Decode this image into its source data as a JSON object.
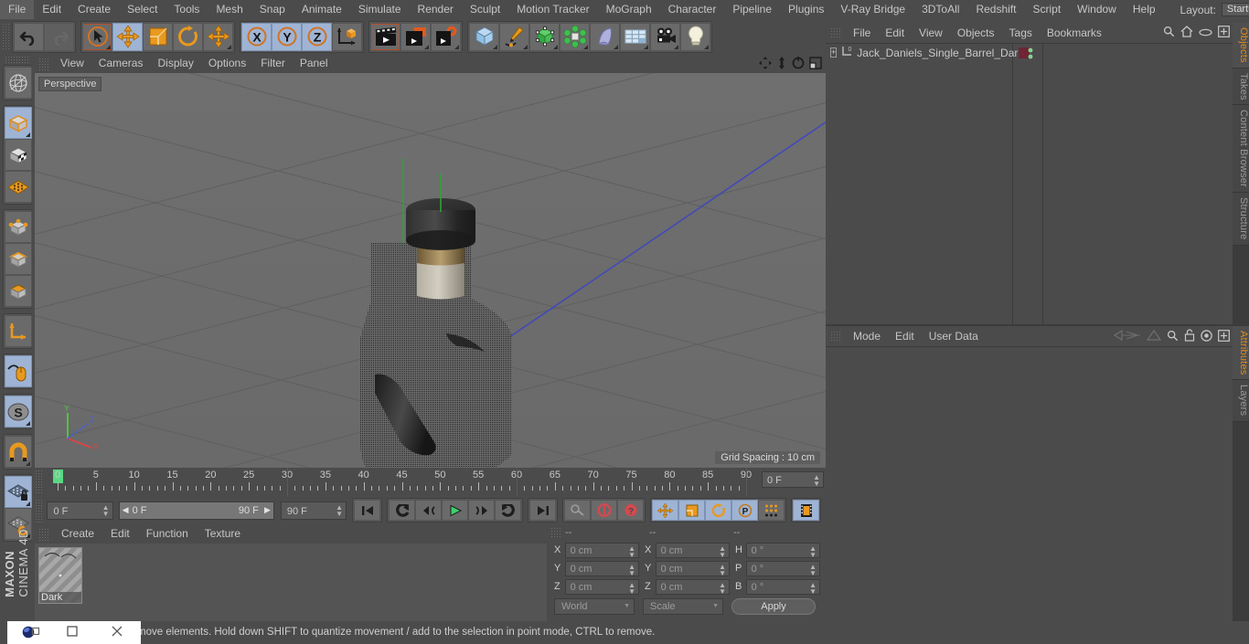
{
  "app": {
    "title": "MAXON CINEMA 4D",
    "brand_line1": "MAXON",
    "brand_line2": "CINEMA 4D"
  },
  "menubar": {
    "items": [
      "File",
      "Edit",
      "Create",
      "Select",
      "Tools",
      "Mesh",
      "Snap",
      "Animate",
      "Simulate",
      "Render",
      "Sculpt",
      "Motion Tracker",
      "MoGraph",
      "Character",
      "Pipeline",
      "Plugins",
      "V-Ray Bridge",
      "3DToAll",
      "Redshift",
      "Script",
      "Window",
      "Help"
    ],
    "layout_label": "Layout:",
    "layout_value": "Startup",
    "search_icon": "search-icon"
  },
  "toolbar": {
    "groups": [
      {
        "name": "history",
        "buttons": [
          {
            "name": "undo-button",
            "icon": "undo-arrow",
            "selected": false,
            "disabled": false
          },
          {
            "name": "redo-button",
            "icon": "redo-arrow",
            "selected": false,
            "disabled": true
          }
        ]
      },
      {
        "name": "transform",
        "buttons": [
          {
            "name": "live-selection-tool",
            "icon": "cursor-circle",
            "selected": false,
            "disabled": false,
            "outlined": true,
            "corner": true
          },
          {
            "name": "move-tool",
            "icon": "move-cross",
            "selected": true,
            "disabled": false
          },
          {
            "name": "scale-tool",
            "icon": "scale-box",
            "selected": false,
            "disabled": false
          },
          {
            "name": "rotate-tool",
            "icon": "rotate-arc",
            "selected": false,
            "disabled": false
          },
          {
            "name": "dynamic-place-tool",
            "icon": "move-cross-small",
            "selected": false,
            "disabled": false,
            "corner": true
          }
        ]
      },
      {
        "name": "axis-locks",
        "buttons": [
          {
            "name": "x-axis-lock",
            "icon": "letter-x",
            "selected": true,
            "disabled": false
          },
          {
            "name": "y-axis-lock",
            "icon": "letter-y",
            "selected": true,
            "disabled": false
          },
          {
            "name": "z-axis-lock",
            "icon": "letter-z",
            "selected": true,
            "disabled": false
          },
          {
            "name": "world-object-coordinates",
            "icon": "axis-cube",
            "selected": false,
            "disabled": false
          }
        ]
      },
      {
        "name": "render",
        "buttons": [
          {
            "name": "render-view-button",
            "icon": "clapperboard",
            "selected": false,
            "disabled": false,
            "outlined": true
          },
          {
            "name": "render-to-picture-viewer-button",
            "icon": "clapperboard-orange",
            "selected": false,
            "disabled": false,
            "corner": true
          },
          {
            "name": "render-settings-button",
            "icon": "clapperboard-gear",
            "selected": false,
            "disabled": false,
            "corner": true
          }
        ]
      },
      {
        "name": "create",
        "buttons": [
          {
            "name": "add-cube-button",
            "icon": "blue-cube",
            "selected": false,
            "disabled": false,
            "corner": true
          },
          {
            "name": "add-spline-button",
            "icon": "pen-spline",
            "selected": false,
            "disabled": false,
            "corner": true
          },
          {
            "name": "add-generator-button",
            "icon": "green-cube",
            "selected": false,
            "disabled": false,
            "corner": true
          },
          {
            "name": "add-mograph-button",
            "icon": "green-cluster",
            "selected": false,
            "disabled": false,
            "corner": true
          },
          {
            "name": "add-deformer-button",
            "icon": "bend-shape",
            "selected": false,
            "disabled": false,
            "corner": true
          },
          {
            "name": "add-scene-object-button",
            "icon": "floor-grid",
            "selected": false,
            "disabled": false,
            "corner": true
          },
          {
            "name": "add-camera-button",
            "icon": "camera",
            "selected": false,
            "disabled": false,
            "corner": true
          },
          {
            "name": "add-light-button",
            "icon": "light-bulb",
            "selected": false,
            "disabled": false,
            "corner": true
          }
        ]
      }
    ]
  },
  "left_palette": {
    "groups": [
      {
        "buttons": [
          {
            "name": "make-editable-button",
            "icon": "wireframe-globe",
            "selected": false
          }
        ]
      },
      {
        "buttons": [
          {
            "name": "model-mode-button",
            "icon": "grey-cube",
            "selected": true,
            "corner": true
          },
          {
            "name": "texture-mode-button",
            "icon": "checker-cube",
            "selected": false
          },
          {
            "name": "workplane-mode-button",
            "icon": "orange-grid-plane",
            "selected": false
          }
        ]
      },
      {
        "buttons": [
          {
            "name": "points-mode-button",
            "icon": "cube-points",
            "selected": false
          },
          {
            "name": "edges-mode-button",
            "icon": "cube-edges",
            "selected": false
          },
          {
            "name": "polygons-mode-button",
            "icon": "cube-polygons",
            "selected": false
          }
        ]
      },
      {
        "buttons": [
          {
            "name": "object-axis-mode-button",
            "icon": "axis-corner",
            "selected": false
          }
        ]
      },
      {
        "buttons": [
          {
            "name": "enable-axis-modification-button",
            "icon": "mouse-axis",
            "selected": true
          }
        ]
      },
      {
        "buttons": [
          {
            "name": "soft-selection-button",
            "icon": "letter-s-sphere",
            "selected": true,
            "corner": true
          }
        ]
      },
      {
        "buttons": [
          {
            "name": "snap-enable-button",
            "icon": "magnet",
            "selected": false,
            "corner": true
          }
        ]
      },
      {
        "buttons": [
          {
            "name": "workplane-lock-button",
            "icon": "grid-lock",
            "selected": true,
            "corner": true
          },
          {
            "name": "planar-workplane-button",
            "icon": "grid-rotate",
            "selected": false,
            "corner": true
          }
        ]
      }
    ]
  },
  "viewport": {
    "menu_items": [
      "View",
      "Cameras",
      "Display",
      "Options",
      "Filter",
      "Panel"
    ],
    "label": "Perspective",
    "grid_spacing": "Grid Spacing : 10 cm",
    "corner_icons": [
      "pan-icon",
      "dolly-icon",
      "rotate-icon",
      "maximize-icon"
    ],
    "axis_gizmo": {
      "x": "X",
      "y": "Y",
      "z": "Z",
      "x_color": "#d84545",
      "y_color": "#53c23f",
      "z_color": "#4a5ed8"
    }
  },
  "timeline": {
    "ticks": [
      0,
      5,
      10,
      15,
      20,
      25,
      30,
      35,
      40,
      45,
      50,
      55,
      60,
      65,
      70,
      75,
      80,
      85,
      90
    ],
    "current_frame_field": "0 F",
    "start_field": "0 F",
    "range_start": "0 F",
    "range_end": "90 F",
    "end_field": "90 F",
    "playback_buttons": [
      {
        "name": "go-to-start-button",
        "icon": "skip-start"
      },
      {
        "name": "go-to-previous-key-button",
        "icon": "prev-key"
      },
      {
        "name": "step-back-button",
        "icon": "step-back"
      },
      {
        "name": "play-button",
        "icon": "play"
      },
      {
        "name": "step-forward-button",
        "icon": "step-forward"
      },
      {
        "name": "go-to-next-key-button",
        "icon": "next-key"
      },
      {
        "name": "go-to-end-button",
        "icon": "skip-end"
      }
    ],
    "record_buttons": [
      {
        "name": "autokeying-button",
        "icon": "key",
        "selected": false
      },
      {
        "name": "record-active-objects-button",
        "icon": "record-red",
        "selected": false
      },
      {
        "name": "keyframe-selection-button",
        "icon": "question-red",
        "selected": false
      }
    ],
    "key_toggles": [
      {
        "name": "position-key-button",
        "icon": "move-cross",
        "selected": true
      },
      {
        "name": "scale-key-button",
        "icon": "scale-box",
        "selected": true
      },
      {
        "name": "rotation-key-button",
        "icon": "rotate-arc",
        "selected": true
      },
      {
        "name": "parameter-key-button",
        "icon": "letter-p",
        "selected": true
      },
      {
        "name": "point-level-animation-button",
        "icon": "dot-grid",
        "selected": false
      },
      {
        "name": "timeline-button",
        "icon": "filmstrip",
        "selected": true
      }
    ]
  },
  "material_manager": {
    "menu_items": [
      "Create",
      "Edit",
      "Function",
      "Texture"
    ],
    "materials": [
      {
        "name": "Dark"
      }
    ]
  },
  "coordinates": {
    "headers": [
      "--",
      "--",
      "--"
    ],
    "rows": [
      {
        "label_pos": "X",
        "value_pos": "0 cm",
        "label_size": "X",
        "value_size": "0 cm",
        "label_rot": "H",
        "value_rot": "0 °"
      },
      {
        "label_pos": "Y",
        "value_pos": "0 cm",
        "label_size": "Y",
        "value_size": "0 cm",
        "label_rot": "P",
        "value_rot": "0 °"
      },
      {
        "label_pos": "Z",
        "value_pos": "0 cm",
        "label_size": "Z",
        "value_size": "0 cm",
        "label_rot": "B",
        "value_rot": "0 °"
      }
    ],
    "system_dropdown": "World",
    "mode_dropdown": "Scale",
    "apply_button": "Apply"
  },
  "object_manager": {
    "menu_items": [
      "File",
      "Edit",
      "View",
      "Objects",
      "Tags",
      "Bookmarks"
    ],
    "header_icons": [
      "search-icon",
      "home-icon",
      "eye-icon",
      "expand-icon"
    ],
    "objects": [
      {
        "name": "Jack_Daniels_Single_Barrel_Dark",
        "layer_badge": "0",
        "tag_color": "#6e2535",
        "expandable": true
      }
    ]
  },
  "attributes": {
    "menu_items": [
      "Mode",
      "Edit",
      "User Data"
    ],
    "header_icons": [
      "back-nav-icon",
      "forward-nav-icon",
      "search-icon",
      "lock-icon",
      "target-icon",
      "expand-icon"
    ]
  },
  "right_tabs": {
    "upper": [
      {
        "label": "Objects",
        "active": true
      },
      {
        "label": "Takes",
        "active": false
      },
      {
        "label": "Content Browser",
        "active": false
      },
      {
        "label": "Structure",
        "active": false
      }
    ],
    "lower": [
      {
        "label": "Attributes",
        "active": true
      },
      {
        "label": "Layers",
        "active": false
      }
    ]
  },
  "statusbar": {
    "message": "move elements. Hold down SHIFT to quantize movement / add to the selection in point mode, CTRL to remove."
  },
  "taskbar": {
    "items": [
      "c4d-app-icon",
      "window-icon",
      "close-icon"
    ]
  },
  "colors": {
    "accent_orange": "#e08b1e",
    "selection_blue": "#9fb4d4",
    "panel_bg": "#4b4b4b",
    "viewport_bg": "#6b6b6b",
    "green_marker": "#58d882"
  }
}
